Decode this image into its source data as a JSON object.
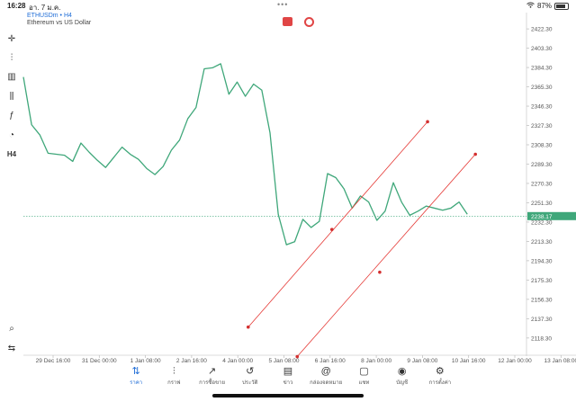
{
  "status": {
    "time": "16:28",
    "date": "อา. 7 ม.ค.",
    "dots": "•••",
    "wifi_icon": "wifi-icon",
    "battery": "87%"
  },
  "symbol": {
    "name": "ETHUSDm • H4",
    "description": "Ethereum vs US Dollar"
  },
  "toolbar": [
    {
      "name": "crosshair-icon",
      "glyph": "✛"
    },
    {
      "name": "candlestick-icon",
      "glyph": "⫶"
    },
    {
      "name": "bar-volume-icon",
      "glyph": "▥"
    },
    {
      "name": "indicators-icon",
      "glyph": "⫼"
    },
    {
      "name": "function-icon",
      "glyph": "ƒ"
    },
    {
      "name": "shapes-icon",
      "glyph": "◔"
    },
    {
      "name": "timeframe-label",
      "glyph": "H4"
    }
  ],
  "toolbar_bottom": [
    {
      "name": "search-zoom-icon",
      "glyph": "⌕"
    },
    {
      "name": "trade-toggle-icon",
      "glyph": "⇆"
    }
  ],
  "chart_icons": [
    {
      "name": "broker-logo-icon",
      "color": "#e04545"
    },
    {
      "name": "refresh-icon",
      "color": "#e04545"
    }
  ],
  "colors": {
    "price_line": "#3fa77a",
    "trend_lines": "#e53935",
    "current_price_bg": "#3fa77a",
    "accent": "#1e6cd6"
  },
  "chart_data": {
    "type": "line",
    "series": [
      {
        "values": [
          2375,
          2328,
          2318,
          2300,
          2299,
          2298,
          2292,
          2310,
          2301,
          2293,
          2286,
          2296,
          2306,
          2299,
          2294,
          2285,
          2279,
          2287,
          2303,
          2313,
          2334,
          2345,
          2383,
          2384,
          2388,
          2358,
          2370,
          2356,
          2368,
          2362,
          2320,
          2240,
          2210,
          2213,
          2235,
          2227,
          2233,
          2280,
          2276,
          2265,
          2246,
          2258,
          2252,
          2234,
          2243,
          2271,
          2252,
          2239,
          2243,
          2248,
          2246,
          2244,
          2246,
          2252,
          2240
        ]
      }
    ],
    "x_tick_labels": [
      "29 Dec 16:00",
      "31 Dec 00:00",
      "1 Jan 08:00",
      "2 Jan 16:00",
      "4 Jan 00:00",
      "5 Jan 08:00",
      "6 Jan 16:00",
      "8 Jan 00:00",
      "9 Jan 08:00",
      "10 Jan 16:00",
      "12 Jan 00:00",
      "13 Jan 08:00"
    ],
    "y_tick_labels": [
      "2422.30",
      "2403.30",
      "2384.30",
      "2365.30",
      "2346.30",
      "2327.30",
      "2308.30",
      "2289.30",
      "2270.30",
      "2251.30",
      "2232.30",
      "2213.30",
      "2194.30",
      "2175.30",
      "2156.30",
      "2137.30",
      "2118.30"
    ],
    "ylim": [
      2104,
      2433
    ],
    "current_price": "2238.17",
    "trend_lines": [
      {
        "points": [
          [
            18.8,
            2129
          ],
          [
            25.8,
            2225
          ],
          [
            33.8,
            2331
          ]
        ]
      },
      {
        "points": [
          [
            22.9,
            2100
          ],
          [
            29.8,
            2183
          ],
          [
            37.8,
            2299
          ]
        ]
      }
    ],
    "x_axis_domain": [
      0,
      42
    ],
    "grid": false
  },
  "nav": [
    {
      "label": "ราคา",
      "icon": "quotes-icon",
      "glyph": "⇅",
      "active": true
    },
    {
      "label": "กราฟ",
      "icon": "chart-icon",
      "glyph": "⫶",
      "active": false
    },
    {
      "label": "การซื้อขาย",
      "icon": "trade-icon",
      "glyph": "↗",
      "active": false
    },
    {
      "label": "ประวัติ",
      "icon": "history-icon",
      "glyph": "↺",
      "active": false
    },
    {
      "label": "ข่าว",
      "icon": "news-icon",
      "glyph": "▤",
      "active": false
    },
    {
      "label": "กล่องจดหมาย",
      "icon": "mailbox-icon",
      "glyph": "@",
      "active": false
    },
    {
      "label": "แชท",
      "icon": "chat-icon",
      "glyph": "▢",
      "active": false
    },
    {
      "label": "บัญชี",
      "icon": "account-icon",
      "glyph": "◉",
      "active": false
    },
    {
      "label": "การตั้งค่า",
      "icon": "settings-icon",
      "glyph": "⚙",
      "active": false
    }
  ]
}
